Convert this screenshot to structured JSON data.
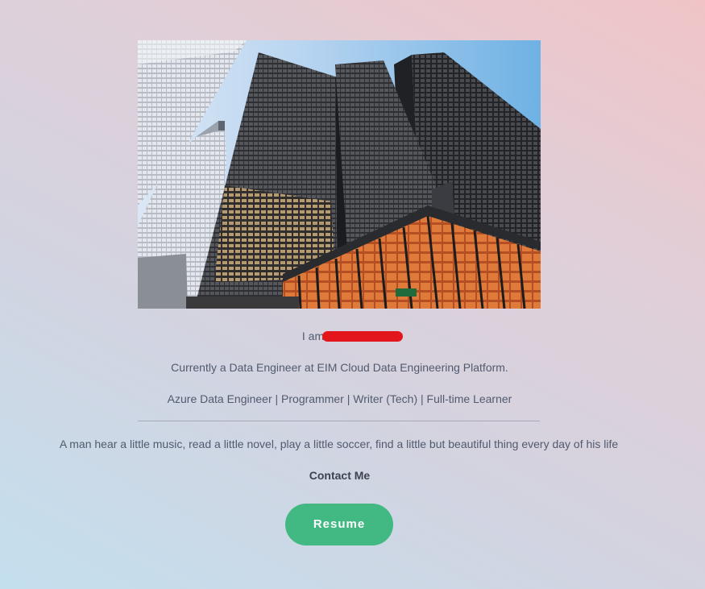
{
  "hero": {
    "image_alt": "Low-angle view of dark glass skyscrapers against a blue sky"
  },
  "intro": {
    "prefix": "I am"
  },
  "current_position": "Currently a Data Engineer at EIM Cloud Data Engineering Platform.",
  "roles": "Azure Data Engineer | Programmer | Writer (Tech) | Full-time Learner",
  "motto": "A man hear a little music, read a little novel, play a little soccer, find a little but beautiful thing every day of his life",
  "contact": {
    "label": "Contact Me"
  },
  "resume": {
    "label": "Resume"
  },
  "colors": {
    "accent": "#42b883",
    "redaction": "#e3161b"
  }
}
